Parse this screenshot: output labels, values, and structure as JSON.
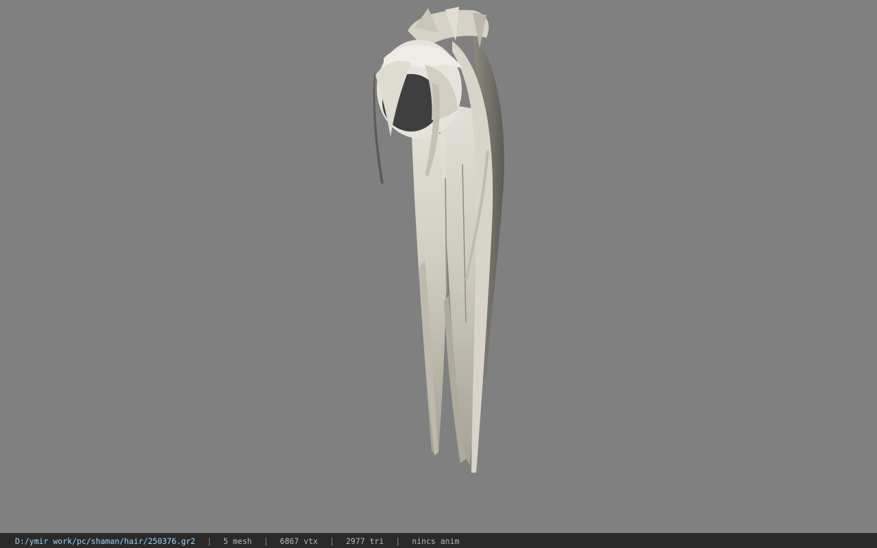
{
  "viewport": {
    "background_color": "#808080",
    "model": "hair-model"
  },
  "status_bar": {
    "file_path": "D:/ymir work/pc/shaman/hair/250376.gr2",
    "separator": "|",
    "mesh": "5 mesh",
    "vertices": "6867 vtx",
    "triangles": "2977 tri",
    "animation": "nincs anim",
    "path_color": "#9ad4ff",
    "text_color": "#b9b9b9"
  }
}
